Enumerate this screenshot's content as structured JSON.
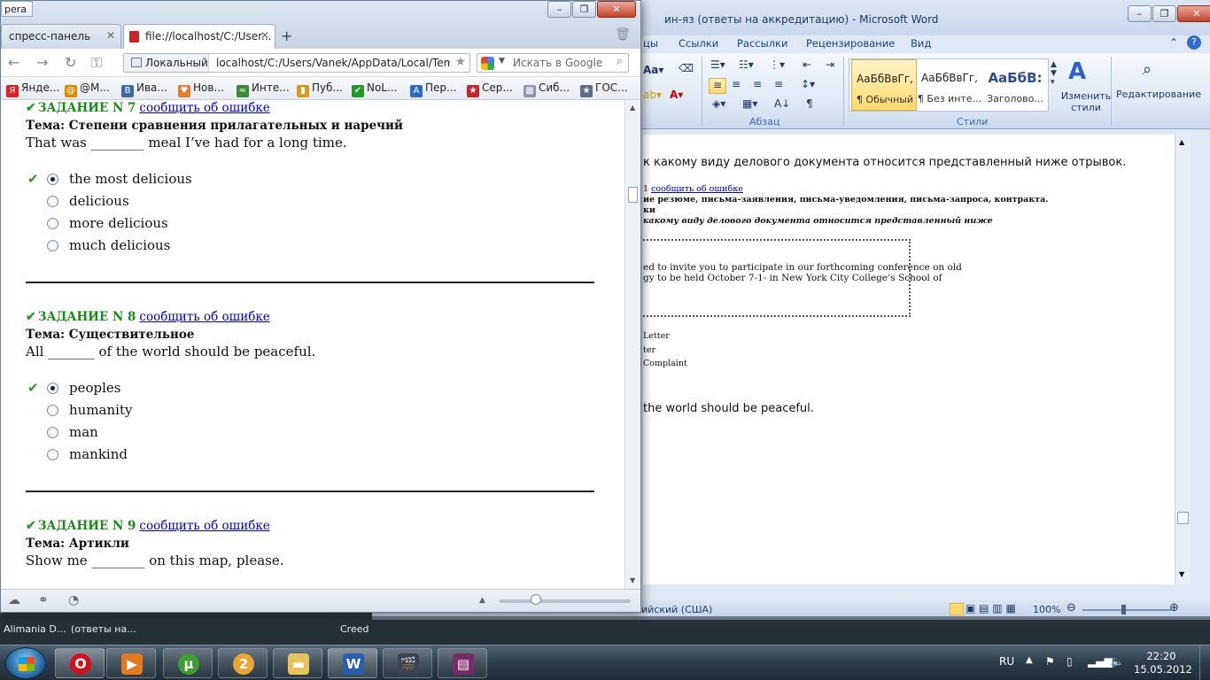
{
  "word": {
    "title": "ин-яз (ответы на аккредитацию)  -  Microsoft Word",
    "tabs": [
      "цы",
      "Ссылки",
      "Рассылки",
      "Рецензирование",
      "Вид"
    ],
    "groups": {
      "paragraph": "Абзац",
      "styles": "Стили"
    },
    "styles": [
      {
        "sample": "АаБбВвГг,",
        "name": "¶ Обычный"
      },
      {
        "sample": "АаБбВвГг,",
        "name": "¶ Без инте..."
      },
      {
        "sample": "АаБбВ:",
        "name": "Заголово..."
      }
    ],
    "change_styles": "Изменить стили",
    "editing": "Редактирование",
    "doc": {
      "line1": "к какому виду делового документа относится представленный ниже отрывок.",
      "link": "сообщить об ошибке",
      "line2": "ие резюме, письма-заявления, письма-уведомления, письма-запроса, контракта.",
      "line3": "ки",
      "line4": "какому виду делового документа относится представленный ниже",
      "box1": "ed to invite you to participate in our forthcoming conference on old",
      "box2": "gy to be held October 7-1- in New York City College’s School of",
      "opt1": "Letter",
      "opt2": "ter",
      "opt3": "Complaint",
      "line5": "the world should be peaceful."
    },
    "status": {
      "lang": "ийский (США)",
      "zoom": "100%"
    }
  },
  "taskbar_behind": {
    "alimania": "Alimania D...",
    "answers": "(ответы на...",
    "creed": "Creed"
  },
  "browser": {
    "opera_label": "pera",
    "tabs": [
      {
        "label": "спресс-панель"
      },
      {
        "label": "file://localhost/C:/User..."
      }
    ],
    "new_tab": "+",
    "address": {
      "zone": "Локальный",
      "url": "localhost/C:/Users/Vanek/AppData/Local/Temp/I"
    },
    "search": {
      "placeholder": "Искать в Google"
    },
    "bookmarks": [
      {
        "label": "Янде...",
        "icon": "Я",
        "color": "#d22"
      },
      {
        "label": "@М...",
        "icon": "@",
        "color": "#e08a00"
      },
      {
        "label": "Ива...",
        "icon": "B",
        "color": "#3b6aa8"
      },
      {
        "label": "Нов...",
        "icon": "♥",
        "color": "#e37a2c"
      },
      {
        "label": "Инте...",
        "icon": "≈",
        "color": "#3a8b3a"
      },
      {
        "label": "Пуб...",
        "icon": "▮",
        "color": "#d89a1c"
      },
      {
        "label": "NoL...",
        "icon": "✔",
        "color": "#1f9a2a"
      },
      {
        "label": "Пер...",
        "icon": "A",
        "color": "#2a6ac8"
      },
      {
        "label": "Сер...",
        "icon": "★",
        "color": "#c8262a"
      },
      {
        "label": "Сиб...",
        "icon": "▦",
        "color": "#8a9ab0"
      },
      {
        "label": "ГОС...",
        "icon": "★",
        "color": "#5a6e8a"
      }
    ],
    "report_link": "сообщить об ошибке",
    "tasks": [
      {
        "heading": "ЗАДАНИЕ N 7",
        "topic": "Тема: Степени сравнения прилагательных и наречий",
        "question": "That was ________ meal I’ve had for a long time.",
        "options": [
          "the most delicious",
          "delicious",
          "more delicious",
          "much delicious"
        ],
        "selected": 0
      },
      {
        "heading": "ЗАДАНИЕ N 8",
        "topic": "Тема: Существительное",
        "question": "All _______ of the world should be peaceful.",
        "options": [
          "peoples",
          "humanity",
          "man",
          "mankind"
        ],
        "selected": 0
      },
      {
        "heading": "ЗАДАНИЕ N 9",
        "topic": "Тема: Артикли",
        "question": "Show me ________ on this map, please."
      }
    ]
  },
  "tray": {
    "lang": "RU",
    "time": "22:20",
    "date": "15.05.2012"
  }
}
